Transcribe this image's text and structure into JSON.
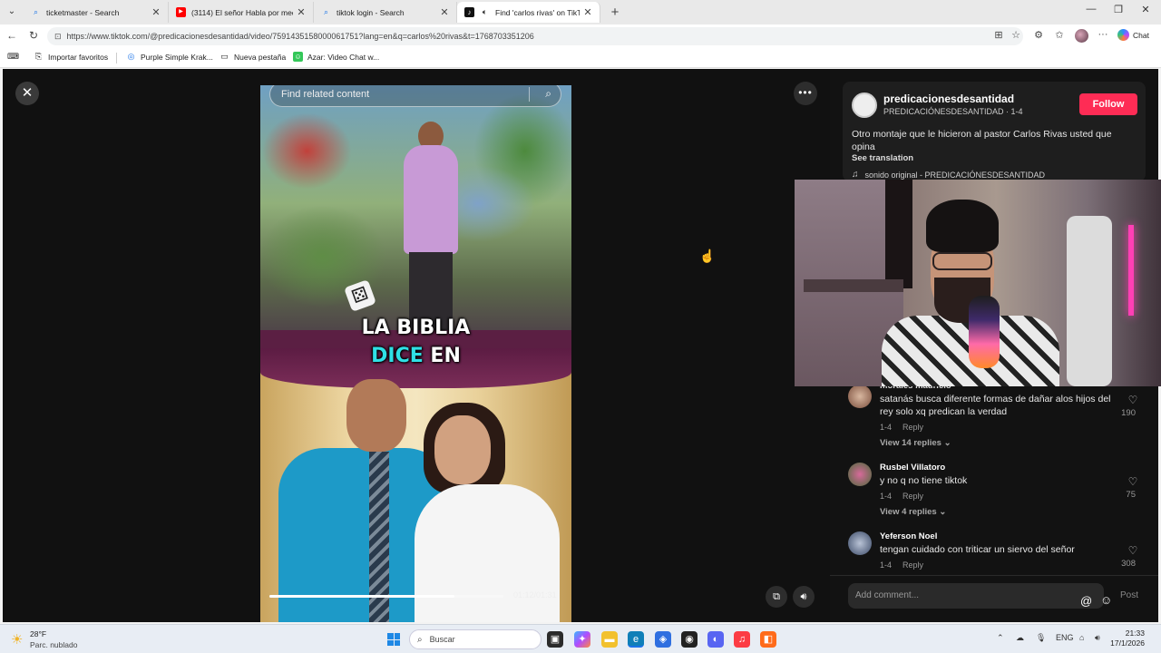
{
  "browser": {
    "tabs": [
      {
        "label": "ticketmaster - Search",
        "icon": "search-icon"
      },
      {
        "label": "(3114) El señor Habla por medio",
        "icon": "youtube-icon"
      },
      {
        "label": "tiktok login - Search",
        "icon": "search-icon"
      },
      {
        "label": "Find 'carlos rivas' on TikTok |",
        "icon": "tiktok-icon",
        "active": true
      }
    ],
    "new_tab": "+",
    "url": "https://www.tiktok.com/@predicacionesdesantidad/video/7591435158000061751?lang=en&q=carlos%20rivas&t=1768703351206",
    "chat_label": "Chat",
    "bookmarks": [
      "Importar favoritos",
      "Purple Simple Krak...",
      "Nueva pestaña",
      "Azar: Video Chat w..."
    ]
  },
  "video": {
    "search_placeholder": "Find related content",
    "caption_line1": "LA BIBLIA",
    "caption_line2_cyan": "DICE",
    "caption_line2_white": " EN",
    "time": "01:12/01:31",
    "progress": 0.79
  },
  "post": {
    "account_name": "predicacionesdesantidad",
    "account_sub": "PREDICACIÓNESDESANTIDAD · 1-4",
    "follow_label": "Follow",
    "description": "Otro montaje que le hicieron al pastor Carlos Rivas usted que opina",
    "see_translation": "See translation",
    "sound": "sonido original - PREDICACIÓNESDESANTIDAD"
  },
  "comments": [
    {
      "user": "morales mauricio",
      "text": "satanás busca diferente formas de dañar alos hijos del rey solo xq predican la verdad",
      "date": "1-4",
      "reply": "Reply",
      "likes": "190",
      "replies": "View 14 replies"
    },
    {
      "user": "Rusbel Villatoro",
      "text": "y no q no tiene tiktok",
      "date": "1-4",
      "reply": "Reply",
      "likes": "75",
      "replies": "View 4 replies"
    },
    {
      "user": "Yeferson Noel",
      "text": "tengan cuidado con triticar un siervo del señor",
      "date": "1-4",
      "reply": "Reply",
      "likes": "308"
    }
  ],
  "comment_box": {
    "placeholder": "Add comment...",
    "post_label": "Post"
  },
  "taskbar": {
    "temp": "28°F",
    "weather": "Parc. nublado",
    "search_label": "Buscar",
    "lang": "ENG",
    "time": "21:33",
    "date": "17/1/2026"
  }
}
